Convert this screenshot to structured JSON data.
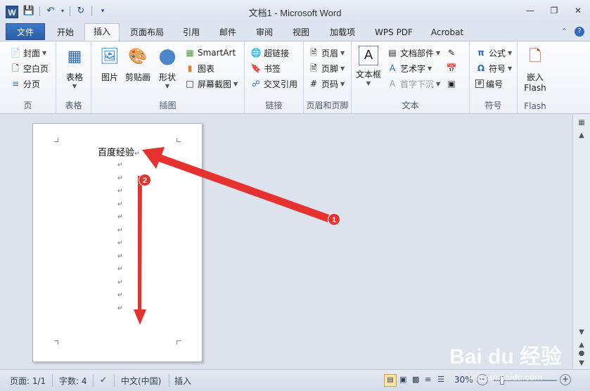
{
  "window": {
    "title": "文档1 - Microsoft Word",
    "app_icon_letter": "W",
    "controls": [
      "minimize-icon",
      "restore-icon",
      "close-icon"
    ]
  },
  "qat": [
    "save-icon",
    "undo-icon",
    "redo-icon",
    "customize-icon"
  ],
  "tabs": {
    "file": "文件",
    "items": [
      "开始",
      "插入",
      "页面布局",
      "引用",
      "邮件",
      "审阅",
      "视图",
      "加载项",
      "WPS PDF",
      "Acrobat"
    ],
    "active": "插入"
  },
  "ribbon": {
    "page": {
      "label": "页",
      "items": [
        "封面",
        "空白页",
        "分页"
      ]
    },
    "table": {
      "label": "表格",
      "button": "表格"
    },
    "illustrations": {
      "label": "插图",
      "picture": "图片",
      "clipart": "剪贴画",
      "shapes": "形状",
      "smartart": "SmartArt",
      "chart": "图表",
      "screenshot": "屏幕截图"
    },
    "links": {
      "label": "链接",
      "items": [
        "超链接",
        "书签",
        "交叉引用"
      ]
    },
    "header_footer": {
      "label": "页眉和页脚",
      "items": [
        "页眉",
        "页脚",
        "页码"
      ]
    },
    "text": {
      "label": "文本",
      "textbox": "文本框",
      "items": [
        "文档部件",
        "艺术字",
        "首字下沉"
      ]
    },
    "symbols": {
      "label": "符号",
      "items": [
        "公式",
        "符号",
        "编号"
      ]
    },
    "flash": {
      "label": "Flash",
      "button_line1": "嵌入",
      "button_line2": "Flash"
    }
  },
  "document": {
    "text": "百度经验",
    "paragraph_mark": "↵",
    "empty_paragraphs": 12
  },
  "annotations": {
    "badge1": "1",
    "badge2": "2",
    "color": "#e5322e"
  },
  "status": {
    "page": "页面: 1/1",
    "words": "字数: 4",
    "language": "中文(中国)",
    "mode": "插入",
    "zoom": "30%",
    "zoom_fraction": 0.3
  },
  "watermark": {
    "brand": "Bai du 经验",
    "url": "jingyan.baidu.com"
  }
}
